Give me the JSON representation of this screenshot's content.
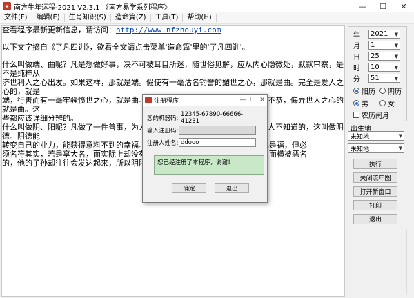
{
  "window": {
    "title": "南方牛年运程-2021  V2.3.1  《南方易学系列程序》",
    "min": "—",
    "max": "☐",
    "close": "✕"
  },
  "menu": [
    "文件(F)",
    "编辑(E)",
    "生肖知识(S)",
    "造命篇(Z)",
    "工具(T)",
    "帮助(H)"
  ],
  "content": {
    "line1_prefix": "查看程序最新更新信息，请访问：",
    "line1_link": "http://www.nfzhouyi.com",
    "line2": "以下文字摘自《了凡四训》，欲看全文请点击菜单'造命篇'里的'了凡四训'。",
    "para1": [
      "什么叫做端、曲呢？凡是想做好事，决不可被耳目所迷，随世俗见解，应从内心隐微处，默默审察，是不是纯粹从",
      "济世利人之心出发。如果这样，那就是端。假使有一毫沽名钓誉的媚世之心，那就是曲。完全是爱人之心的，就是",
      "端，行善而有一毫牢骚愤世之心，就是曲。纯是敬人之心的就是端，有一毫玩世不恭，侮弄世人之心的就是曲。这",
      "些都应该详细分辨的。"
    ],
    "para2": [
      "什么叫做阴、阳呢？凡做了一件善事，为人们所知道的，叫做阳善，做了善事别人不知道的，这叫做阴德。阴德能",
      "转变自己的业力，能获得意料不到的幸福。阳善                                名远扬也是福，但必",
      "须名符其实，若是享大名，而实际上却没有真实                                可逃的人而横被恶名",
      "的，他的子孙却往往会发达起来，所以阴阳之间"
    ]
  },
  "side": {
    "year_label": "年",
    "year_value": "2021",
    "month_label": "月",
    "month_value": "1",
    "day_label": "日",
    "day_value": "25",
    "hour_label": "时",
    "hour_value": "10",
    "minute_label": "分",
    "minute_value": "51",
    "solar": "阳历",
    "lunar": "阴历",
    "male": "男",
    "female": "女",
    "leap": "农历闰月",
    "birth_label": "出生地",
    "place1": "未知地",
    "place2": "未知地",
    "buttons": [
      "执行",
      "关闭流年图",
      "打开新窗口",
      "打印",
      "退出"
    ]
  },
  "dialog": {
    "title": "注册程序",
    "machine_label": "您的机器码:",
    "machine_value": "12345-67890-66666-41231",
    "code_label": "输入注册码:",
    "code_value": "",
    "name_label": "注册人姓名:",
    "name_value": "ddooo",
    "message": "您已经注册了本程序，谢谢！",
    "ok": "确定",
    "cancel": "退出"
  }
}
